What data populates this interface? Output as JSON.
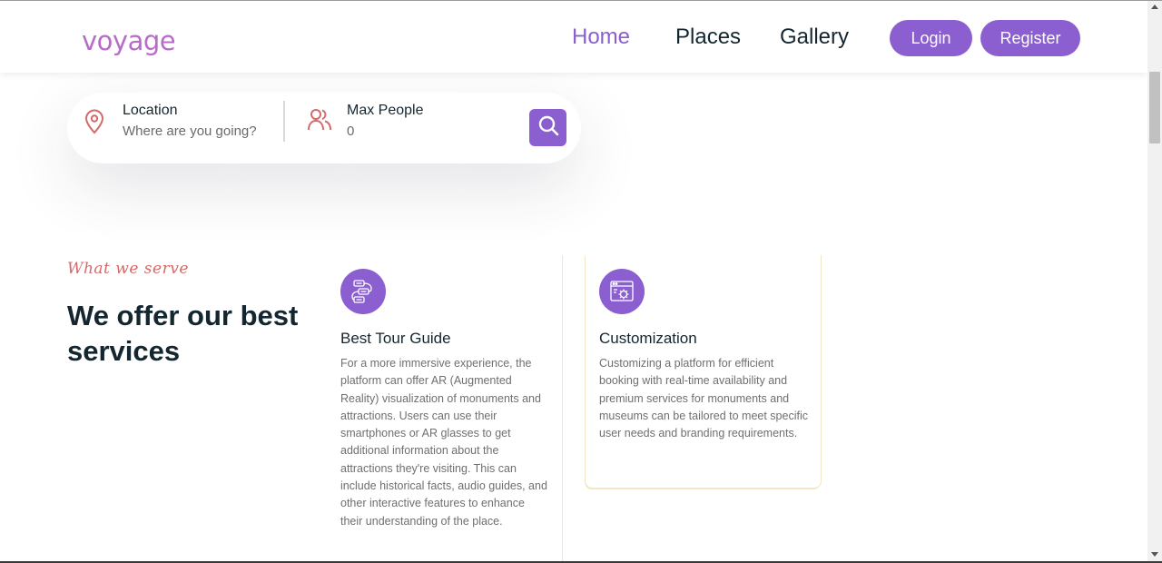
{
  "header": {
    "logo": "voyage",
    "nav": [
      "Home",
      "Places",
      "Gallery"
    ],
    "login_label": "Login",
    "register_label": "Register"
  },
  "search": {
    "location_label": "Location",
    "location_placeholder": "Where are you going?",
    "people_label": "Max People",
    "people_value": "0",
    "icons": [
      "location-pin-icon",
      "users-icon",
      "search-icon"
    ]
  },
  "services": {
    "tagline": "What we serve",
    "title": "We offer our best services",
    "cards": [
      {
        "title": "Best Tour Guide",
        "icon": "tour-guide-icon",
        "text": "For a more immersive experience, the platform can offer AR (Augmented Reality) visualization of monuments and attractions. Users can use their smartphones or AR glasses to get additional information about the attractions they're visiting. This can include historical facts, audio guides, and other interactive features to enhance their understanding of the place."
      },
      {
        "title": "Customization",
        "icon": "customization-icon",
        "text": "Customizing a platform for efficient booking with real-time availability and premium services for monuments and museums can be tailored to meet specific user needs and branding requirements."
      }
    ]
  },
  "colors": {
    "accent": "#8b5fcf",
    "logo": "#b86bc9",
    "tagline": "#d46a6a",
    "text": "#14262f"
  }
}
